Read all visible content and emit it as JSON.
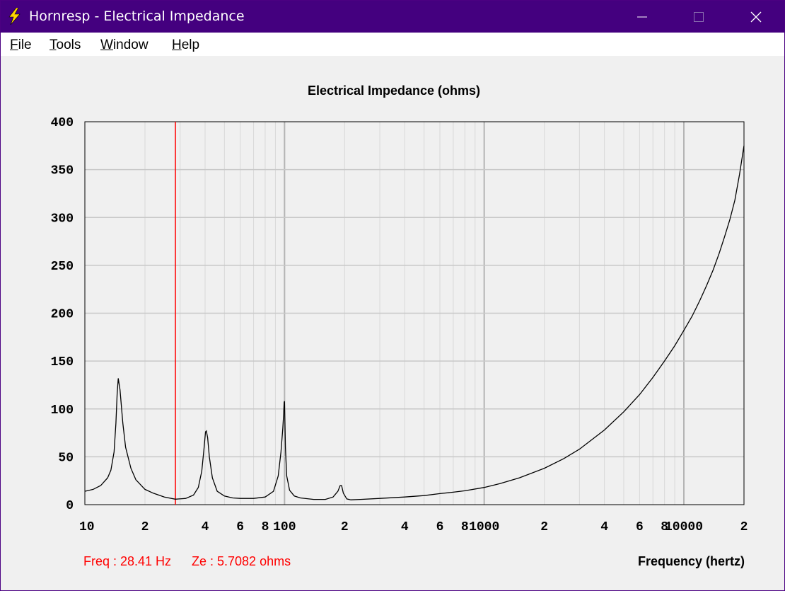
{
  "window": {
    "title": "Hornresp - Electrical Impedance",
    "icon": "lightning-bolt-icon",
    "controls": [
      "minimize-icon",
      "maximize-icon",
      "close-icon"
    ]
  },
  "menu": [
    {
      "key": "F",
      "rest": "ile"
    },
    {
      "key": "T",
      "rest": "ools"
    },
    {
      "key": "W",
      "rest": "indow"
    },
    {
      "key": "H",
      "rest": "elp"
    }
  ],
  "readout": {
    "freq": "Freq : 28.41 Hz",
    "ze": "Ze : 5.7082 ohms"
  },
  "colors": {
    "titlebar": "#44007f",
    "curve": "#000000",
    "cursor": "#ff0000",
    "readout": "#ff0000",
    "grid": "#c8c8c8"
  },
  "chart_data": {
    "type": "line",
    "title": "Electrical Impedance (ohms)",
    "xlabel": "Frequency (hertz)",
    "ylabel": "",
    "x_scale": "log",
    "xlim": [
      10,
      20000
    ],
    "ylim": [
      0,
      400
    ],
    "y_ticks": [
      0,
      50,
      100,
      150,
      200,
      250,
      300,
      350,
      400
    ],
    "x_tick_labels": [
      {
        "x": 10,
        "label": "10"
      },
      {
        "x": 20,
        "label": "2"
      },
      {
        "x": 40,
        "label": "4"
      },
      {
        "x": 60,
        "label": "6"
      },
      {
        "x": 80,
        "label": "8"
      },
      {
        "x": 100,
        "label": "100"
      },
      {
        "x": 200,
        "label": "2"
      },
      {
        "x": 400,
        "label": "4"
      },
      {
        "x": 600,
        "label": "6"
      },
      {
        "x": 800,
        "label": "8"
      },
      {
        "x": 1000,
        "label": "1000"
      },
      {
        "x": 2000,
        "label": "2"
      },
      {
        "x": 4000,
        "label": "4"
      },
      {
        "x": 6000,
        "label": "6"
      },
      {
        "x": 8000,
        "label": "8"
      },
      {
        "x": 10000,
        "label": "10000"
      },
      {
        "x": 20000,
        "label": "2"
      }
    ],
    "grid": true,
    "cursor_x": 28.41,
    "series": [
      {
        "x": [
          10,
          11,
          12,
          13,
          13.5,
          14,
          14.3,
          14.5,
          14.7,
          15,
          15.5,
          16,
          17,
          18,
          20,
          22,
          25,
          28.41,
          32,
          35,
          37,
          38.5,
          39.5,
          40.2,
          40.6,
          41.2,
          42,
          43.5,
          46,
          50,
          55,
          60,
          70,
          80,
          88,
          93,
          96,
          98,
          99,
          99.6,
          100,
          100.4,
          101,
          102.5,
          106,
          112,
          120,
          140,
          160,
          175,
          185,
          190,
          193,
          197,
          205,
          215,
          240,
          300,
          400,
          500,
          600,
          700,
          800,
          1000,
          1200,
          1500,
          2000,
          2500,
          3000,
          4000,
          5000,
          6000,
          7000,
          8000,
          9000,
          10000,
          11000,
          12000,
          13000,
          14000,
          15000,
          16000,
          17000,
          18000,
          19000,
          20000
        ],
        "y": [
          14,
          16,
          20,
          28,
          36,
          55,
          85,
          115,
          132,
          120,
          85,
          60,
          38,
          26,
          16,
          12,
          8,
          5.7,
          6.5,
          10,
          18,
          35,
          58,
          76,
          77,
          70,
          50,
          28,
          14,
          9,
          7,
          6.5,
          6.5,
          8,
          14,
          30,
          55,
          80,
          95,
          107,
          108,
          90,
          60,
          30,
          15,
          9,
          7,
          5.5,
          5.5,
          8,
          14,
          20,
          20,
          12,
          6,
          5,
          5.5,
          6.5,
          8,
          9.5,
          11.5,
          13,
          14.5,
          18,
          22,
          28,
          38,
          48,
          58,
          78,
          97,
          115,
          133,
          150,
          166,
          182,
          197,
          213,
          229,
          245,
          262,
          280,
          298,
          318,
          345,
          375
        ]
      }
    ]
  }
}
